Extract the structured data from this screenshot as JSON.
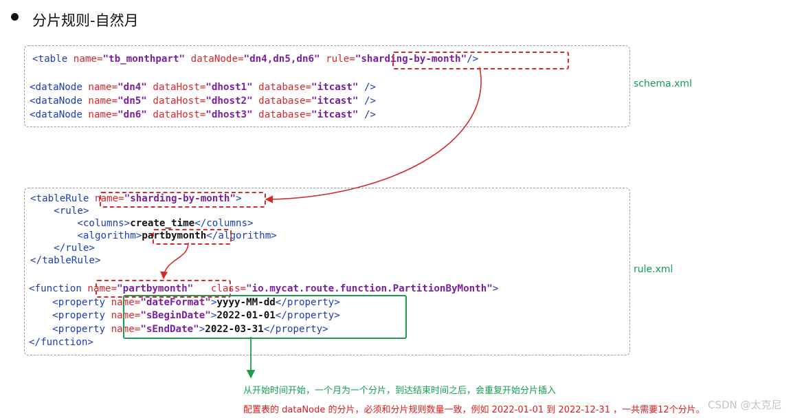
{
  "title": "分片规则-自然月",
  "schema": {
    "file_label": "schema.xml",
    "table_line": {
      "open": "<table",
      "name_attr": "name=",
      "name_val": "\"tb_monthpart\"",
      "dn_attr": "dataNode=",
      "dn_val": "\"dn4,dn5,dn6\"",
      "rule_attr": "rule=",
      "rule_val": "\"sharding-by-month\"",
      "close": "/>"
    },
    "datanodes": [
      {
        "open": "<dataNode",
        "name_attr": "name=",
        "name_val": "\"dn4\"",
        "host_attr": "dataHost=",
        "host_val": "\"dhost1\"",
        "db_attr": "database=",
        "db_val": "\"itcast\"",
        "close": "/>"
      },
      {
        "open": "<dataNode",
        "name_attr": "name=",
        "name_val": "\"dn5\"",
        "host_attr": "dataHost=",
        "host_val": "\"dhost2\"",
        "db_attr": "database=",
        "db_val": "\"itcast\"",
        "close": "/>"
      },
      {
        "open": "<dataNode",
        "name_attr": "name=",
        "name_val": "\"dn6\"",
        "host_attr": "dataHost=",
        "host_val": "\"dhost3\"",
        "db_attr": "database=",
        "db_val": "\"itcast\"",
        "close": "/>"
      }
    ]
  },
  "rule": {
    "file_label": "rule.xml",
    "tablerule_open": "<tableRule",
    "tablerule_name_attr": "name=",
    "tablerule_name_val": "\"sharding-by-month\"",
    "tablerule_close_bracket": ">",
    "rule_open": "<rule>",
    "columns_open": "<columns>",
    "columns_val": "create_time",
    "columns_close": "</columns>",
    "algorithm_open": "<algorithm>",
    "algorithm_val": "partbymonth",
    "algorithm_close": "</algorithm>",
    "rule_close": "</rule>",
    "tablerule_close": "</tableRule>",
    "function_open": "<function",
    "function_name_attr": "name=",
    "function_name_val": "\"partbymonth\"",
    "function_class_attr": "class=",
    "function_class_val": "\"io.mycat.route.function.PartitionByMonth\"",
    "function_close_bracket": ">",
    "properties": [
      {
        "open": "<property",
        "name_attr": "name=",
        "name_val": "\"dateFormat\"",
        "gt": ">",
        "value": "yyyy-MM-dd",
        "close": "</property>"
      },
      {
        "open": "<property",
        "name_attr": "name=",
        "name_val": "\"sBeginDate\"",
        "gt": ">",
        "value": "2022-01-01",
        "close": "</property>"
      },
      {
        "open": "<property",
        "name_attr": "name=",
        "name_val": "\"sEndDate\"",
        "gt": ">",
        "value": "2022-03-31",
        "close": "</property>"
      }
    ],
    "function_close": "</function>"
  },
  "notes": {
    "green": "从开始时间开始，一个月为一个分片，到达结束时间之后，会重复开始分片插入",
    "red": "配置表的 dataNode 的分片，必须和分片规则数量一致，例如 2022-01-01 到 2022-12-31 ，一共需要12个分片。"
  },
  "watermark": "CSDN @太克尼",
  "colors": {
    "tag": "#1c3cb8",
    "attr": "#d6272e",
    "value": "#7a1fa0",
    "highlight_red": "#d42a2a",
    "highlight_green": "#1f9a4e",
    "label_green": "#13995a"
  }
}
